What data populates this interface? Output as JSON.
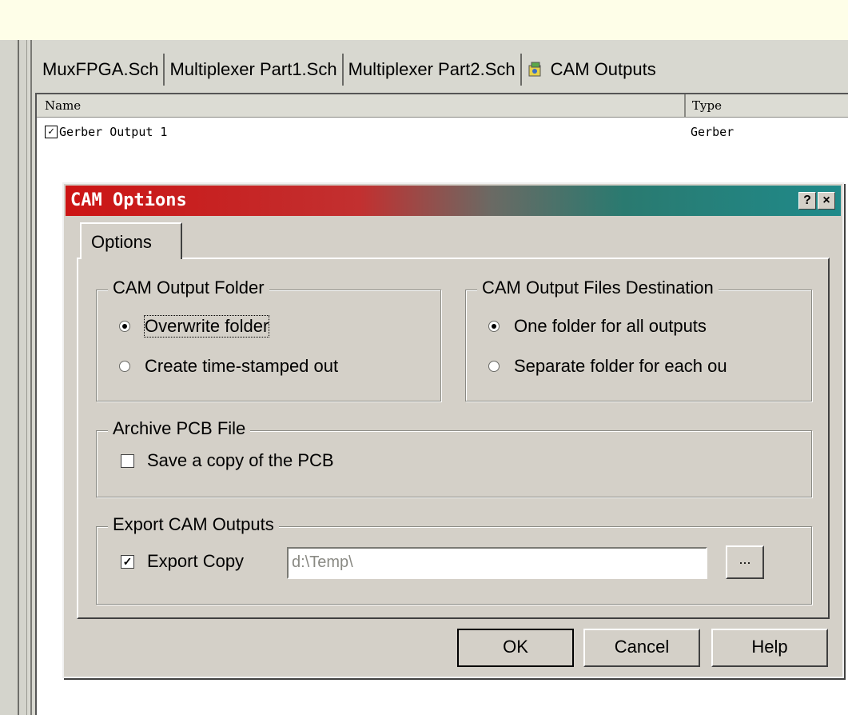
{
  "tabs": [
    {
      "label": "MuxFPGA.Sch"
    },
    {
      "label": "Multiplexer Part1.Sch"
    },
    {
      "label": "Multiplexer Part2.Sch"
    },
    {
      "label": "CAM Outputs",
      "icon": "cam-outputs-icon"
    }
  ],
  "list": {
    "header_name": "Name",
    "header_type": "Type",
    "rows": [
      {
        "checked": true,
        "check_mark": "✓",
        "name": "Gerber Output 1",
        "type": "Gerber"
      }
    ]
  },
  "dialog": {
    "title": "CAM Options",
    "help_btn": "?",
    "close_btn": "×",
    "tab_label": "Options",
    "output_folder": {
      "legend": "CAM Output Folder",
      "opt1": "Overwrite folder",
      "opt2": "Create time-stamped out",
      "selected": 1
    },
    "destination": {
      "legend": "CAM Output Files Destination",
      "opt1": "One folder for all outputs",
      "opt2": "Separate folder for each ou",
      "selected": 1
    },
    "archive": {
      "legend": "Archive PCB File",
      "save_copy": "Save a copy of the PCB",
      "checked": false
    },
    "export": {
      "legend": "Export CAM Outputs",
      "export_copy": "Export Copy",
      "checked": true,
      "check_mark": "✓",
      "path": "d:\\Temp\\",
      "browse": "..."
    },
    "buttons": {
      "ok": "OK",
      "cancel": "Cancel",
      "help": "Help"
    }
  },
  "colors": {
    "titlebar_start": "#cc1414",
    "titlebar_end": "#1f8a8a",
    "face": "#d4d0c8"
  }
}
